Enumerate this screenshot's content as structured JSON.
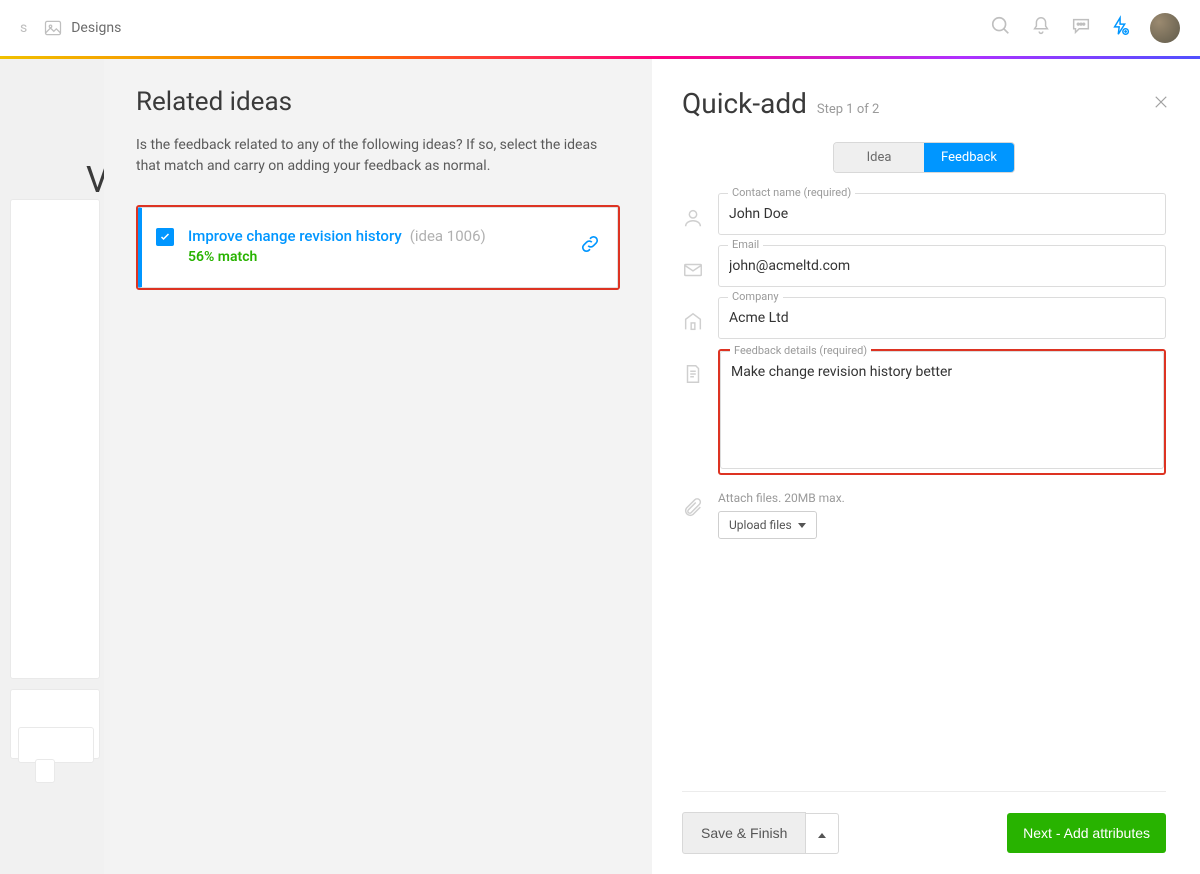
{
  "header": {
    "nav_label": "Designs"
  },
  "related": {
    "title": "Related ideas",
    "intro": "Is the feedback related to any of the following ideas? If so, select the ideas that match and carry on adding your feedback as normal.",
    "idea": {
      "title": "Improve change revision history",
      "ref": "(idea 1006)",
      "match": "56% match"
    }
  },
  "quickadd": {
    "title": "Quick-add",
    "step": "Step 1 of 2",
    "toggle": {
      "idea": "Idea",
      "feedback": "Feedback"
    },
    "labels": {
      "contact": "Contact name (required)",
      "email": "Email",
      "company": "Company",
      "details": "Feedback details (required)"
    },
    "values": {
      "contact": "John Doe",
      "email": "john@acmeltd.com",
      "company": "Acme Ltd",
      "details": "Make change revision history better"
    },
    "attach_hint": "Attach files. 20MB max.",
    "upload_label": "Upload files"
  },
  "footer": {
    "save": "Save & Finish",
    "next": "Next - Add attributes"
  }
}
